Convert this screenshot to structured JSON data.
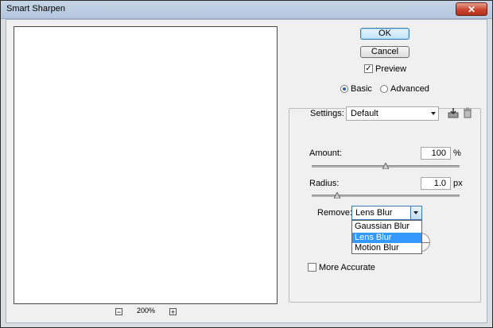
{
  "window": {
    "title": "Smart Sharpen",
    "close_glyph": "✕"
  },
  "preview": {
    "zoom_out": "−",
    "zoom_level": "200%",
    "zoom_in": "+"
  },
  "buttons": {
    "ok": "OK",
    "cancel": "Cancel"
  },
  "preview_checkbox": {
    "label": "Preview",
    "checked": true,
    "mark": "✓"
  },
  "mode": {
    "basic": "Basic",
    "advanced": "Advanced",
    "selected": "basic"
  },
  "settings": {
    "label": "Settings:",
    "value": "Default",
    "save_icon": "save-settings-icon",
    "delete_icon": "trash-icon"
  },
  "amount": {
    "label": "Amount:",
    "value": "100",
    "unit": "%",
    "level": 0.5
  },
  "radius": {
    "label": "Radius:",
    "value": "1.0",
    "unit": "px",
    "level": 0.17
  },
  "remove": {
    "label": "Remove:",
    "value": "Lens Blur",
    "options": [
      "Gaussian Blur",
      "Lens Blur",
      "Motion Blur"
    ],
    "selected_index": 1
  },
  "more_accurate": {
    "label": "More Accurate",
    "checked": false
  },
  "colors": {
    "accent": "#3399ff",
    "titlebar": "#b5c7de",
    "close": "#c8442d"
  }
}
